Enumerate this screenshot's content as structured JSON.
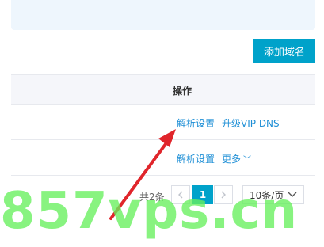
{
  "toolbar": {
    "add_domain_label": "添加域名"
  },
  "table": {
    "header_ops": "操作",
    "rows": [
      {
        "op1": "解析设置",
        "op2": "升级VIP DNS"
      },
      {
        "op1": "解析设置",
        "op2": "更多"
      }
    ]
  },
  "pagination": {
    "total_text": "共2条",
    "current_page": "1",
    "page_size": "10条/页"
  },
  "watermark": {
    "text": "857vps.cn"
  },
  "colors": {
    "accent": "#00a2ca",
    "link": "#1e8fd6",
    "arrow": "#e0252b",
    "watermark": "#66f05c"
  },
  "icons": {
    "prev": "chevron-left-icon",
    "next": "chevron-right-icon",
    "dropdown": "chevron-down-icon"
  }
}
